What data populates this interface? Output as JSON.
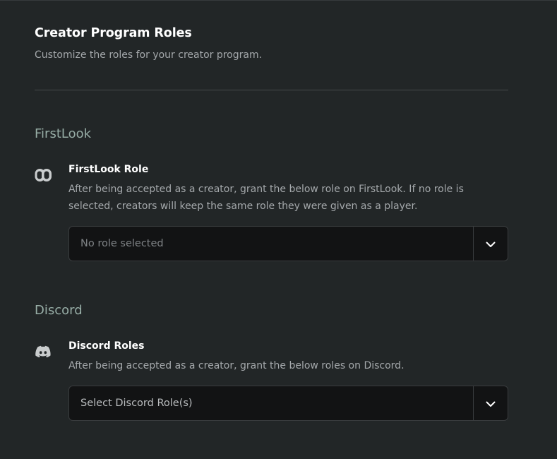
{
  "header": {
    "title": "Creator Program Roles",
    "subtitle": "Customize the roles for your creator program."
  },
  "sections": [
    {
      "title": "FirstLook",
      "setting": {
        "icon": "firstlook-logo-icon",
        "label": "FirstLook Role",
        "description": "After being accepted as a creator, grant the below role on FirstLook. If no role is selected, creators will keep the same role they were given as a player.",
        "select_value": "No role selected"
      }
    },
    {
      "title": "Discord",
      "setting": {
        "icon": "discord-logo-icon",
        "label": "Discord Roles",
        "description": "After being accepted as a creator, grant the below roles on Discord.",
        "select_value": "Select Discord Role(s)"
      }
    }
  ],
  "colors": {
    "background": "#222627",
    "section_title": "#97ada6",
    "muted_text": "#a4a8ab",
    "select_background": "#121314"
  }
}
